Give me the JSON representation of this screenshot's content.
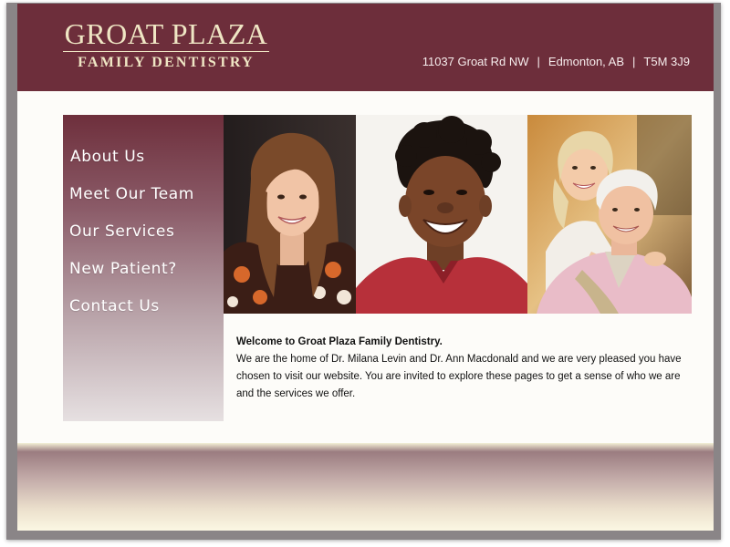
{
  "logo": {
    "line1": "GROAT PLAZA",
    "line2": "FAMILY DENTISTRY"
  },
  "address": {
    "street": "11037 Groat Rd NW",
    "city": "Edmonton, AB",
    "postal": "T5M 3J9",
    "separator": "|"
  },
  "nav": {
    "items": [
      {
        "label": "About Us"
      },
      {
        "label": "Meet Our Team"
      },
      {
        "label": "Our Services"
      },
      {
        "label": "New Patient?"
      },
      {
        "label": "Contact Us"
      }
    ]
  },
  "welcome": {
    "title": "Welcome to Groat Plaza Family Dentistry.",
    "body": "We are the home of Dr. Milana Levin and Dr. Ann Macdonald and we are very pleased you have chosen to visit our website. You are invited to explore these pages to get a sense of who we are and the services we offer."
  },
  "colors": {
    "header_bg": "#6d2e3b",
    "logo_text": "#efe6c4",
    "page_bg": "#fdfcf9"
  }
}
